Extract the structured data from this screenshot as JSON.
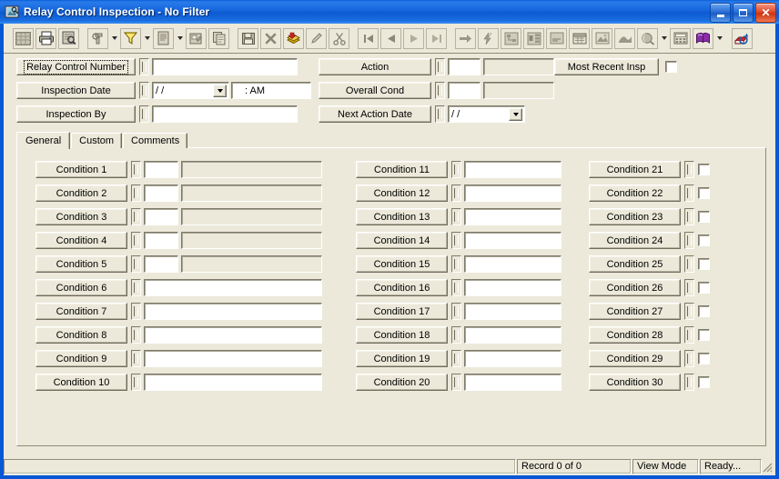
{
  "window": {
    "title": "Relay Control Inspection - No Filter",
    "icon": "app-inspection-icon",
    "minimize_label": "Minimize",
    "maximize_label": "Maximize",
    "close_label": "Close",
    "accent_color": "#1868de",
    "face_color": "#ece9da"
  },
  "toolbar": {
    "groups": [
      {
        "buttons": [
          {
            "name": "select-grid-icon",
            "glyph": "grid"
          },
          {
            "name": "print-icon",
            "glyph": "printer"
          },
          {
            "name": "print-preview-icon",
            "glyph": "preview"
          }
        ]
      },
      {
        "buttons": [
          {
            "name": "find-icon",
            "glyph": "binoculars",
            "dropdown": true
          },
          {
            "name": "filter-icon",
            "glyph": "funnel",
            "dropdown": true
          },
          {
            "name": "report-icon",
            "glyph": "document",
            "dropdown": true
          },
          {
            "name": "properties-icon",
            "glyph": "properties"
          },
          {
            "name": "copy-record-icon",
            "glyph": "copy"
          }
        ]
      },
      {
        "buttons": [
          {
            "name": "save-icon",
            "glyph": "floppy"
          },
          {
            "name": "delete-icon",
            "glyph": "x-mark"
          },
          {
            "name": "new-record-icon",
            "glyph": "stack"
          },
          {
            "name": "edit-icon",
            "glyph": "pencil"
          },
          {
            "name": "cut-icon",
            "glyph": "scissors"
          }
        ]
      },
      {
        "buttons": [
          {
            "name": "first-record-icon",
            "glyph": "first"
          },
          {
            "name": "previous-record-icon",
            "glyph": "prev"
          },
          {
            "name": "next-record-icon",
            "glyph": "next"
          },
          {
            "name": "last-record-icon",
            "glyph": "last"
          }
        ]
      },
      {
        "buttons": [
          {
            "name": "goto-record-icon",
            "glyph": "arrow-right"
          },
          {
            "name": "quick-action-icon",
            "glyph": "lightning"
          },
          {
            "name": "hierarchy-icon",
            "glyph": "tree"
          },
          {
            "name": "structure-icon",
            "glyph": "structure"
          },
          {
            "name": "notes-icon",
            "glyph": "notes"
          },
          {
            "name": "schedule-icon",
            "glyph": "calendar"
          },
          {
            "name": "image-icon",
            "glyph": "picture"
          },
          {
            "name": "map-icon",
            "glyph": "map"
          },
          {
            "name": "search-location-icon",
            "glyph": "globe",
            "dropdown": true
          },
          {
            "name": "calculator-icon",
            "glyph": "calculator"
          },
          {
            "name": "help-book-icon",
            "glyph": "book",
            "dropdown": true
          }
        ]
      },
      {
        "buttons": [
          {
            "name": "exit-icon",
            "glyph": "exit"
          }
        ]
      }
    ]
  },
  "header": {
    "left_fields": [
      {
        "name": "relay-control-number",
        "label": "Relay Control Number",
        "focused": true,
        "has_lookup": true,
        "value": "",
        "control": "text"
      },
      {
        "name": "inspection-date",
        "label": "Inspection Date",
        "focused": false,
        "has_lookup": true,
        "value": "/  /",
        "control": "date",
        "time_value": ":      AM"
      },
      {
        "name": "inspection-by",
        "label": "Inspection By",
        "focused": false,
        "has_lookup": true,
        "value": "",
        "control": "text"
      }
    ],
    "mid_fields": [
      {
        "name": "action",
        "label": "Action",
        "has_lookup": true,
        "code_value": "",
        "desc_value": "",
        "control": "code-desc"
      },
      {
        "name": "overall-cond",
        "label": "Overall Cond",
        "has_lookup": true,
        "code_value": "",
        "desc_value": "",
        "control": "code-desc"
      },
      {
        "name": "next-action-date",
        "label": "Next Action Date",
        "has_lookup": true,
        "value": "/  /",
        "control": "date"
      }
    ],
    "right_field": {
      "name": "most-recent-insp",
      "label": "Most Recent Insp",
      "checked": false
    }
  },
  "tabs": [
    {
      "name": "tab-general",
      "label": "General",
      "active": true
    },
    {
      "name": "tab-custom",
      "label": "Custom",
      "active": false
    },
    {
      "name": "tab-comments",
      "label": "Comments",
      "active": false
    }
  ],
  "general_tab": {
    "columns": [
      {
        "name": "condition-column-1",
        "rows": [
          {
            "label": "Condition 1",
            "type": "code-desc",
            "code_value": "",
            "desc_value": "",
            "desc_disabled": true
          },
          {
            "label": "Condition 2",
            "type": "code-desc",
            "code_value": "",
            "desc_value": "",
            "desc_disabled": true
          },
          {
            "label": "Condition 3",
            "type": "code-desc",
            "code_value": "",
            "desc_value": "",
            "desc_disabled": true
          },
          {
            "label": "Condition 4",
            "type": "code-desc",
            "code_value": "",
            "desc_value": "",
            "desc_disabled": true
          },
          {
            "label": "Condition 5",
            "type": "code-desc",
            "code_value": "",
            "desc_value": "",
            "desc_disabled": true
          },
          {
            "label": "Condition 6",
            "type": "text",
            "value": ""
          },
          {
            "label": "Condition 7",
            "type": "text",
            "value": ""
          },
          {
            "label": "Condition 8",
            "type": "text",
            "value": ""
          },
          {
            "label": "Condition 9",
            "type": "text",
            "value": ""
          },
          {
            "label": "Condition 10",
            "type": "text",
            "value": ""
          }
        ]
      },
      {
        "name": "condition-column-2",
        "rows": [
          {
            "label": "Condition 11",
            "type": "text",
            "value": ""
          },
          {
            "label": "Condition 12",
            "type": "text",
            "value": ""
          },
          {
            "label": "Condition 13",
            "type": "text",
            "value": ""
          },
          {
            "label": "Condition 14",
            "type": "text",
            "value": ""
          },
          {
            "label": "Condition 15",
            "type": "text",
            "value": ""
          },
          {
            "label": "Condition 16",
            "type": "text",
            "value": ""
          },
          {
            "label": "Condition 17",
            "type": "text",
            "value": ""
          },
          {
            "label": "Condition 18",
            "type": "text",
            "value": ""
          },
          {
            "label": "Condition 19",
            "type": "text",
            "value": ""
          },
          {
            "label": "Condition 20",
            "type": "text",
            "value": ""
          }
        ]
      },
      {
        "name": "condition-column-3",
        "rows": [
          {
            "label": "Condition 21",
            "type": "checkbox",
            "checked": false
          },
          {
            "label": "Condition 22",
            "type": "checkbox",
            "checked": false
          },
          {
            "label": "Condition 23",
            "type": "checkbox",
            "checked": false
          },
          {
            "label": "Condition 24",
            "type": "checkbox",
            "checked": false
          },
          {
            "label": "Condition 25",
            "type": "checkbox",
            "checked": false
          },
          {
            "label": "Condition 26",
            "type": "checkbox",
            "checked": false
          },
          {
            "label": "Condition 27",
            "type": "checkbox",
            "checked": false
          },
          {
            "label": "Condition 28",
            "type": "checkbox",
            "checked": false
          },
          {
            "label": "Condition 29",
            "type": "checkbox",
            "checked": false
          },
          {
            "label": "Condition 30",
            "type": "checkbox",
            "checked": false
          }
        ]
      }
    ]
  },
  "statusbar": {
    "record_counter": "Record 0 of 0",
    "mode": "View Mode",
    "state": "Ready..."
  }
}
